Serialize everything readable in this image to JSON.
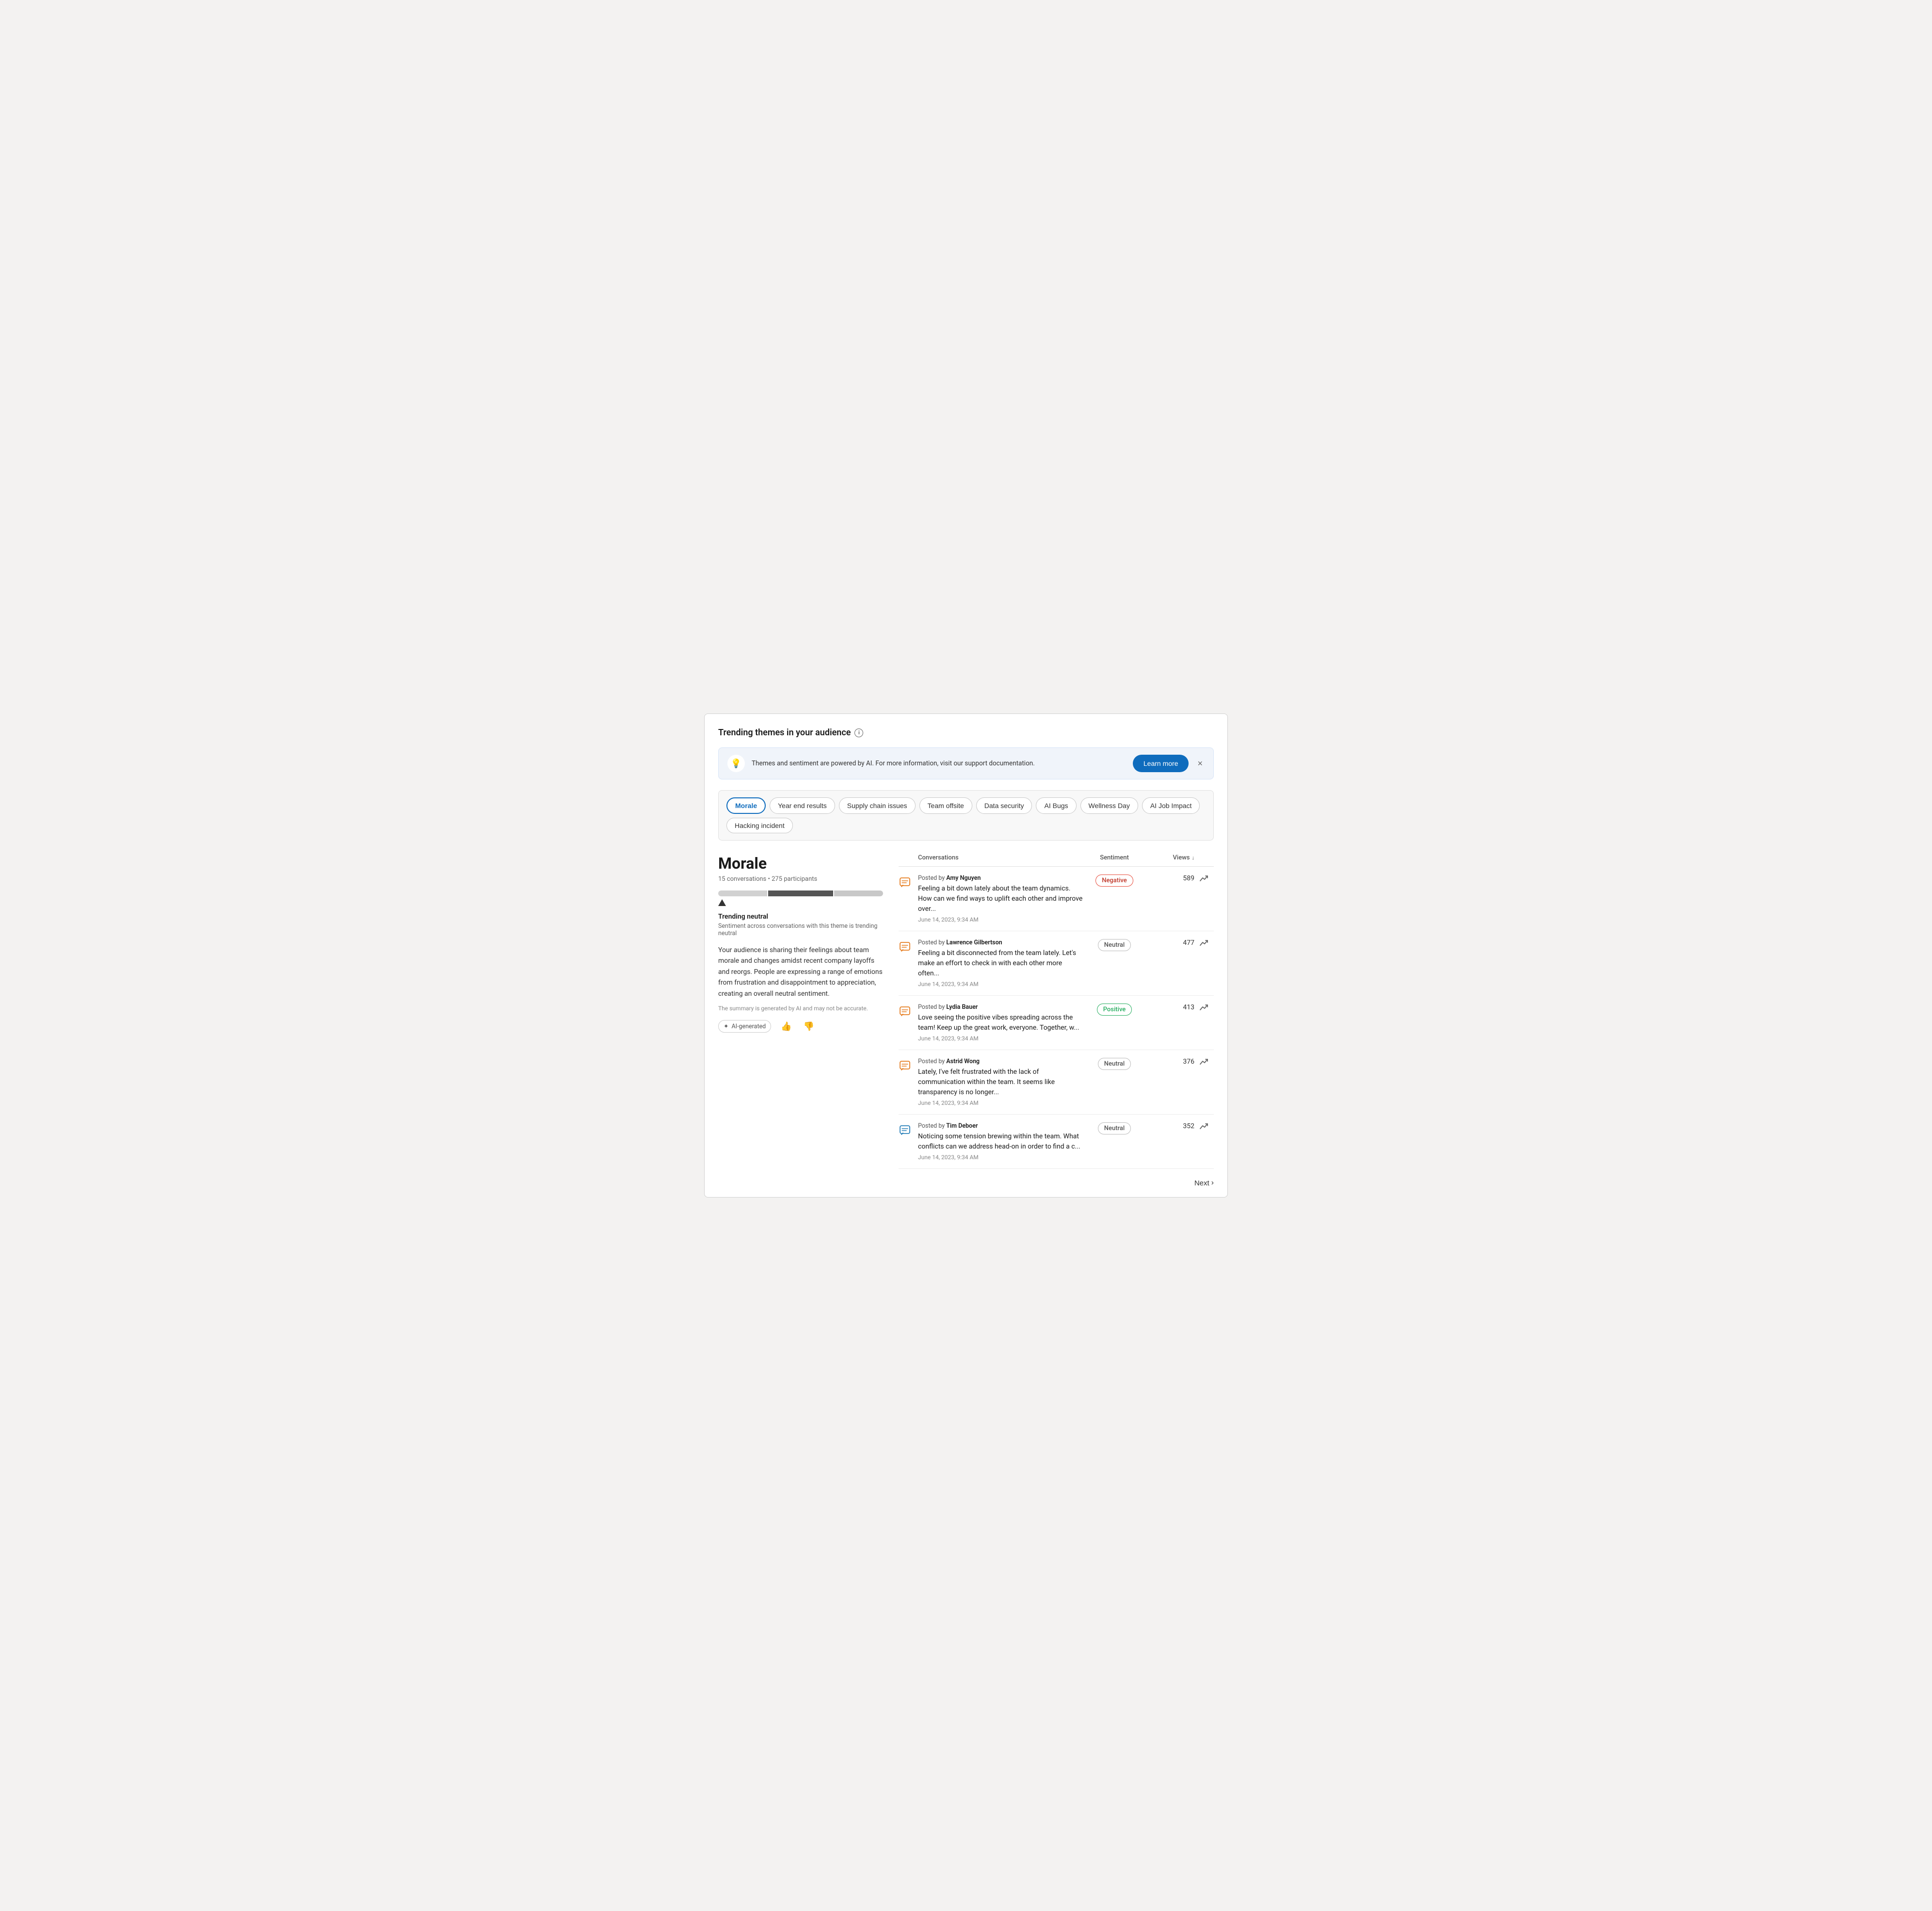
{
  "page": {
    "title": "Trending themes in your audience",
    "info_icon": "i"
  },
  "banner": {
    "icon": "💡",
    "text": "Themes and sentiment are powered by AI. For more information, visit our support documentation.",
    "learn_more_label": "Learn more",
    "close_label": "×"
  },
  "tabs": [
    {
      "id": "morale",
      "label": "Morale",
      "active": true
    },
    {
      "id": "year-end-results",
      "label": "Year end results",
      "active": false
    },
    {
      "id": "supply-chain-issues",
      "label": "Supply chain issues",
      "active": false
    },
    {
      "id": "team-offsite",
      "label": "Team offsite",
      "active": false
    },
    {
      "id": "data-security",
      "label": "Data security",
      "active": false
    },
    {
      "id": "ai-bugs",
      "label": "AI Bugs",
      "active": false
    },
    {
      "id": "wellness-day",
      "label": "Wellness Day",
      "active": false
    },
    {
      "id": "ai-job-impact",
      "label": "AI Job Impact",
      "active": false
    },
    {
      "id": "hacking-incident",
      "label": "Hacking incident",
      "active": false
    }
  ],
  "theme": {
    "title": "Morale",
    "conversations_count": "15 conversations",
    "participants_count": "275 participants",
    "trending_label": "Trending neutral",
    "trending_desc": "Sentiment across conversations with this theme is trending neutral",
    "summary": "Your audience is sharing their feelings about team morale and changes amidst recent company layoffs and reorgs. People are expressing a range of emotions from frustration and disappointment to appreciation, creating an overall neutral sentiment.",
    "ai_disclaimer": "The summary is generated by AI and may not be accurate.",
    "ai_badge_label": "AI-generated",
    "thumbs_up_icon": "👍",
    "thumbs_down_icon": "👎"
  },
  "table": {
    "col_conversations": "Conversations",
    "col_sentiment": "Sentiment",
    "col_views": "Views",
    "sort_icon": "↓",
    "rows": [
      {
        "posted_by": "Amy Nguyen",
        "text": "Feeling a bit down lately about the team dynamics. How can we find ways to uplift each other and improve over...",
        "date": "June 14, 2023, 9:34 AM",
        "sentiment": "Negative",
        "sentiment_class": "negative",
        "views": "589",
        "icon_color": "orange"
      },
      {
        "posted_by": "Lawrence Gilbertson",
        "text": "Feeling a bit disconnected from the team lately. Let's make an effort to check in with each other more often...",
        "date": "June 14, 2023, 9:34 AM",
        "sentiment": "Neutral",
        "sentiment_class": "neutral",
        "views": "477",
        "icon_color": "orange"
      },
      {
        "posted_by": "Lydia Bauer",
        "text": "Love seeing the positive vibes spreading across the team! Keep up the great work, everyone. Together, w...",
        "date": "June 14, 2023, 9:34 AM",
        "sentiment": "Positive",
        "sentiment_class": "positive",
        "views": "413",
        "icon_color": "orange"
      },
      {
        "posted_by": "Astrid Wong",
        "text": "Lately, I've felt frustrated with the lack of communication within the team. It seems like transparency is no longer...",
        "date": "June 14, 2023, 9:34 AM",
        "sentiment": "Neutral",
        "sentiment_class": "neutral",
        "views": "376",
        "icon_color": "orange"
      },
      {
        "posted_by": "Tim Deboer",
        "text": "Noticing some tension brewing within the team. What conflicts can we address head-on in order to find a c...",
        "date": "June 14, 2023, 9:34 AM",
        "sentiment": "Neutral",
        "sentiment_class": "neutral",
        "views": "352",
        "icon_color": "blue"
      }
    ]
  },
  "pagination": {
    "next_label": "Next"
  }
}
